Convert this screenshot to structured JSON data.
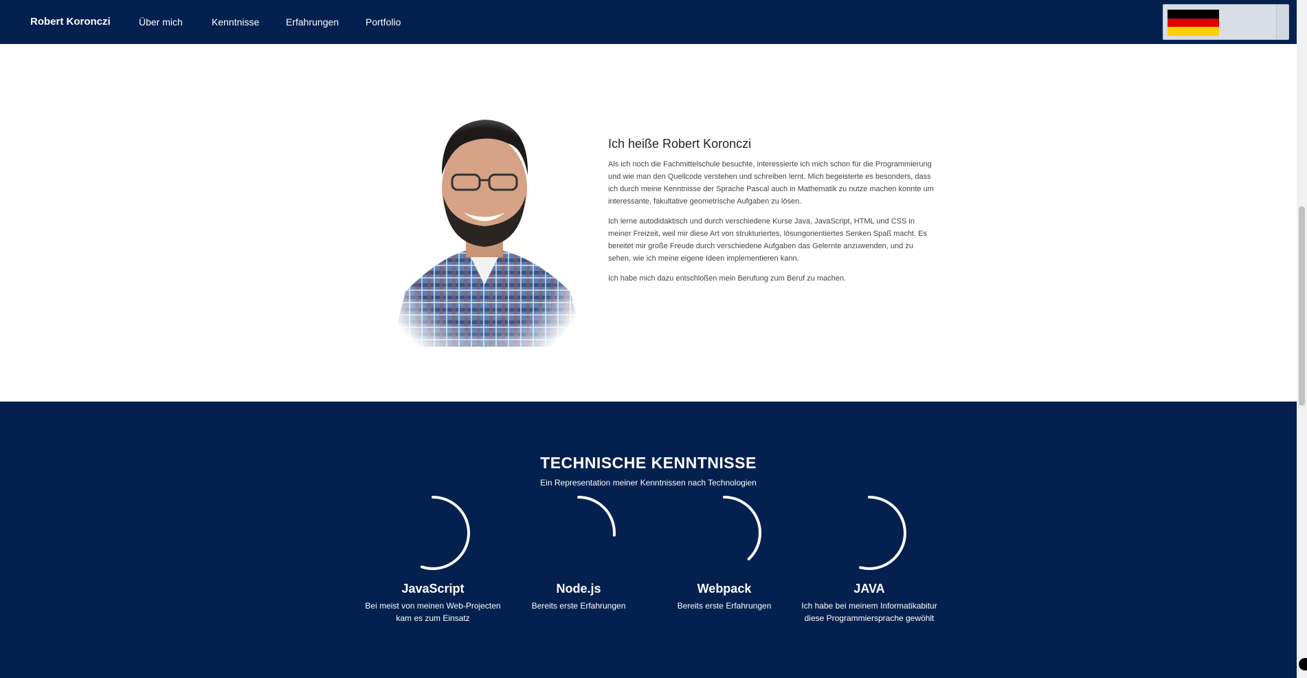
{
  "nav": {
    "brand": "Robert Koronczi",
    "links": [
      "Über mich",
      "Kenntnisse",
      "Erfahrungen",
      "Portfolio"
    ],
    "language_icon": "flag-germany-icon",
    "flag_colors": [
      "#000000",
      "#dd0000",
      "#ffce00"
    ]
  },
  "about": {
    "title": "Ich heiße Robert Koronczi",
    "paragraphs": [
      "Als ich noch die Fachmittelschule besuchte, interessierte ich mich schon für die Programmierung und wie man den Quellcode verstehen und schreiben lernt. Mich begeisterte es besonders, dass ich durch meine Kenntnisse der Sprache Pascal auch in Mathematik zu nutze machen konnte um interessante, fakultative geometrische Aufgaben zu lösen.",
      "Ich lerne autodidaktisch und durch verschiedene Kurse Java, JavaScript, HTML und CSS in meiner Freizeit, weil mir diese Art von strukturiertes, lösungorientiertes Senken Spaß macht. Es bereitet mir große Freude durch verschiedene Aufgaben das Gelernte anzuwenden, und zu sehen, wie ich meine eigene Ideen implementieren kann.",
      "Ich habe mich dazu entschloßen mein Berufung zum Beruf zu machen."
    ]
  },
  "skills": {
    "title": "TECHNISCHE KENNTNISSE",
    "subtitle": "Ein Representation meiner Kenntnissen nach Technologien",
    "items": [
      {
        "name": "JavaScript",
        "desc_line1": "Bei meist von meinen Web-Projecten",
        "desc_line2": "kam es zum Einsatz",
        "level": 0.55
      },
      {
        "name": "Node.js",
        "desc_line1": "Bereits erste Erfahrungen",
        "desc_line2": "",
        "level": 0.26
      },
      {
        "name": "Webpack",
        "desc_line1": "Bereits erste Erfahrungen",
        "desc_line2": "",
        "level": 0.38
      },
      {
        "name": "JAVA",
        "desc_line1": "Ich habe bei meinem Informatikabitur",
        "desc_line2": "diese Programmiersprache gewöhlt",
        "level": 0.54
      }
    ],
    "accent": "#ffffff",
    "background": "#03204f"
  }
}
